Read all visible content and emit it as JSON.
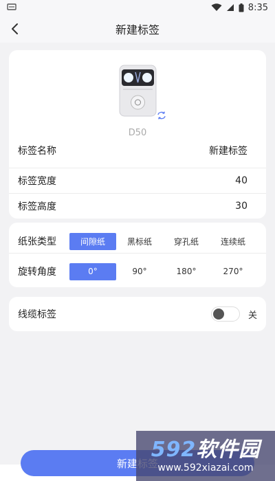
{
  "status_bar": {
    "left_icon": "notification-icon",
    "time": "8:35",
    "icons": [
      "wifi-icon",
      "signal-icon",
      "battery-icon"
    ]
  },
  "nav": {
    "title": "新建标签",
    "back_icon": "back-arrow-icon"
  },
  "device": {
    "name": "D50",
    "image": "label-printer-image",
    "switch_icon": "switch-device-icon"
  },
  "label_info": {
    "name_label": "标签名称",
    "name_value": "新建标签",
    "width_label": "标签宽度",
    "width_value": "40",
    "height_label": "标签高度",
    "height_value": "30"
  },
  "paper_type": {
    "label": "纸张类型",
    "options": [
      "间隙纸",
      "黑标纸",
      "穿孔纸",
      "连续纸"
    ],
    "selected": "间隙纸"
  },
  "rotation": {
    "label": "旋转角度",
    "options": [
      "0°",
      "90°",
      "180°",
      "270°"
    ],
    "selected": "0°"
  },
  "cable_label": {
    "label": "线缆标签",
    "state_text": "关",
    "enabled": false
  },
  "actions": {
    "create_button": "新建标签"
  },
  "watermark": {
    "digits": "592",
    "brand": "软件园",
    "url": "www.592xiazai.com"
  },
  "colors": {
    "accent": "#5b7cf2",
    "background": "#f2f2f4",
    "card": "#ffffff"
  }
}
